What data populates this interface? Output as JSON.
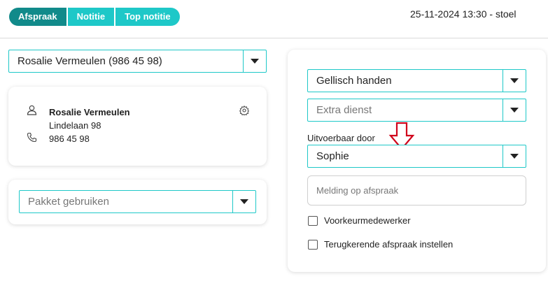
{
  "tabs": [
    {
      "label": "Afspraak"
    },
    {
      "label": "Notitie"
    },
    {
      "label": "Top notitie"
    }
  ],
  "datetime": "25-11-2024 13:30 - stoel",
  "client_select": {
    "value": "Rosalie Vermeulen (986 45 98)"
  },
  "client_card": {
    "name": "Rosalie Vermeulen",
    "street": "Lindelaan 98",
    "phone": "986 45 98",
    "icons": [
      "person-icon",
      "phone-icon",
      "gear-icon"
    ]
  },
  "package_select": {
    "placeholder": "Pakket gebruiken"
  },
  "service_select": {
    "value": "Gellisch handen"
  },
  "extra_select": {
    "placeholder": "Extra dienst"
  },
  "performed_by": {
    "label": "Uitvoerbaar door",
    "value": "Sophie"
  },
  "message_input": {
    "placeholder": "Melding op afspraak"
  },
  "checkboxes": [
    {
      "label": "Voorkeurmedewerker",
      "checked": false
    },
    {
      "label": "Terugkerende afspraak instellen",
      "checked": false
    }
  ],
  "colors": {
    "accent": "#1ec8c8",
    "accent_dark": "#118a8a",
    "annotation_arrow": "#d0021b"
  }
}
